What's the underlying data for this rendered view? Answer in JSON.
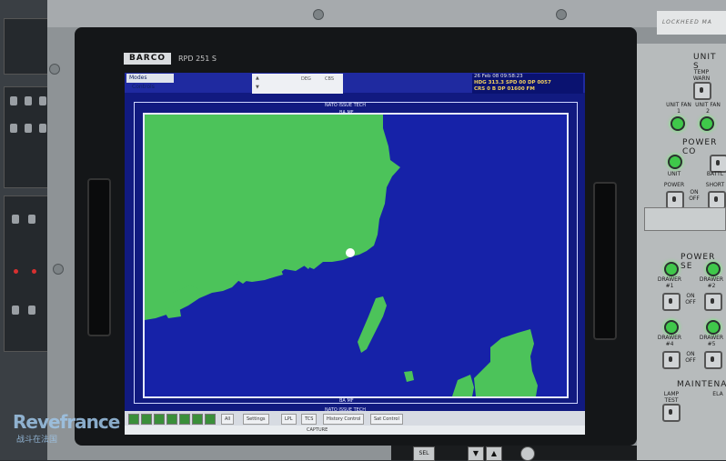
{
  "monitor": {
    "brand": "BARCO",
    "model": "RPD 251 S"
  },
  "screen": {
    "modes_label": "Modes",
    "controls_label": "Controls",
    "popup": {
      "row1": "DEG",
      "row2": "CBS"
    },
    "readout": {
      "line1": "26 Feb 08 09:58:23",
      "line2": "HDG 313.3  SPD 00  DP 0057",
      "line3": "CRS 0 B  DP 01600 FM"
    },
    "map_label_top": "NATO ISSUE TECH",
    "map_label_mid_top": "BA MF",
    "map_label_mid_bottom": "BA MF",
    "map_label_bottom": "NATO ISSUE TECH",
    "map_colors": {
      "land": "#4cc35a",
      "sea": "#1622a8"
    },
    "toolbar": {
      "buttons": [
        "All",
        "Settings",
        "LPL",
        "TCS",
        "History Control",
        "Sat Control"
      ]
    },
    "status_text": "CAPTURE"
  },
  "panel": {
    "title_unit": "UNIT S",
    "temp_warn": "TEMP WARN",
    "unit_fan_1": "UNIT FAN 1",
    "unit_fan_2": "UNIT FAN 2",
    "power_co": "POWER CO",
    "unit": "UNIT",
    "battl": "BATTL",
    "power": "POWER",
    "on_off": "ON OFF",
    "short": "SHORT",
    "power_se": "POWER SE",
    "drawer_1": "DRAWER #1",
    "drawer_2": "DRAWER #2",
    "drawer_4": "DRAWER #4",
    "drawer_5": "DRAWER #5",
    "maintenan": "MAINTENAN",
    "lamp_test": "LAMP TEST",
    "ela": "ELA",
    "company": "LOCKHEED MA"
  },
  "watermark": {
    "title": "Revefrance",
    "subtitle": "战斗在法国"
  },
  "bottom": {
    "buttons": [
      "SEL",
      "▼",
      "▲"
    ]
  }
}
